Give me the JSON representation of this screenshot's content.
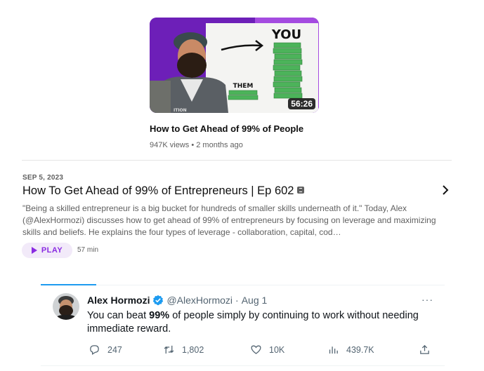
{
  "video": {
    "thumbnail_text_top": "YOU",
    "thumbnail_text_bottom": "THEM",
    "thumbnail_shirt_text": "ITION",
    "duration": "56:26",
    "title": "How to Get Ahead of 99% of People",
    "views": "947K views",
    "separator": "•",
    "age": "2 months ago"
  },
  "episode": {
    "date": "SEP 5, 2023",
    "title": "How To Get Ahead of 99% of Entrepreneurs | Ep 602",
    "description": "\"Being a skilled entrepreneur is a big bucket for hundreds of smaller skills underneath of it.\" Today, Alex (@AlexHormozi) discusses how to get ahead of 99% of entrepreneurs by focusing on leverage and maximizing skills and beliefs. He explains the four types of leverage - collaboration, capital, cod…",
    "play_label": "PLAY",
    "duration": "57 min",
    "explicit_icon": "explicit-badge-icon",
    "chevron_icon": "chevron-right-icon"
  },
  "tweet": {
    "name": "Alex Hormozi",
    "handle": "@AlexHormozi",
    "dot": "·",
    "date": "Aug 1",
    "more": "···",
    "text_before": "You can beat ",
    "text_bold": "99%",
    "text_after": " of people simply by continuing to work without needing immediate reward.",
    "replies": "247",
    "retweets": "1,802",
    "likes": "10K",
    "views": "439.7K",
    "accent_color": "#1d9bf0",
    "verified_color": "#1d9bf0"
  },
  "colors": {
    "podcast_accent": "#8a2be2",
    "thumbnail_bg": "#6d1fb8"
  }
}
